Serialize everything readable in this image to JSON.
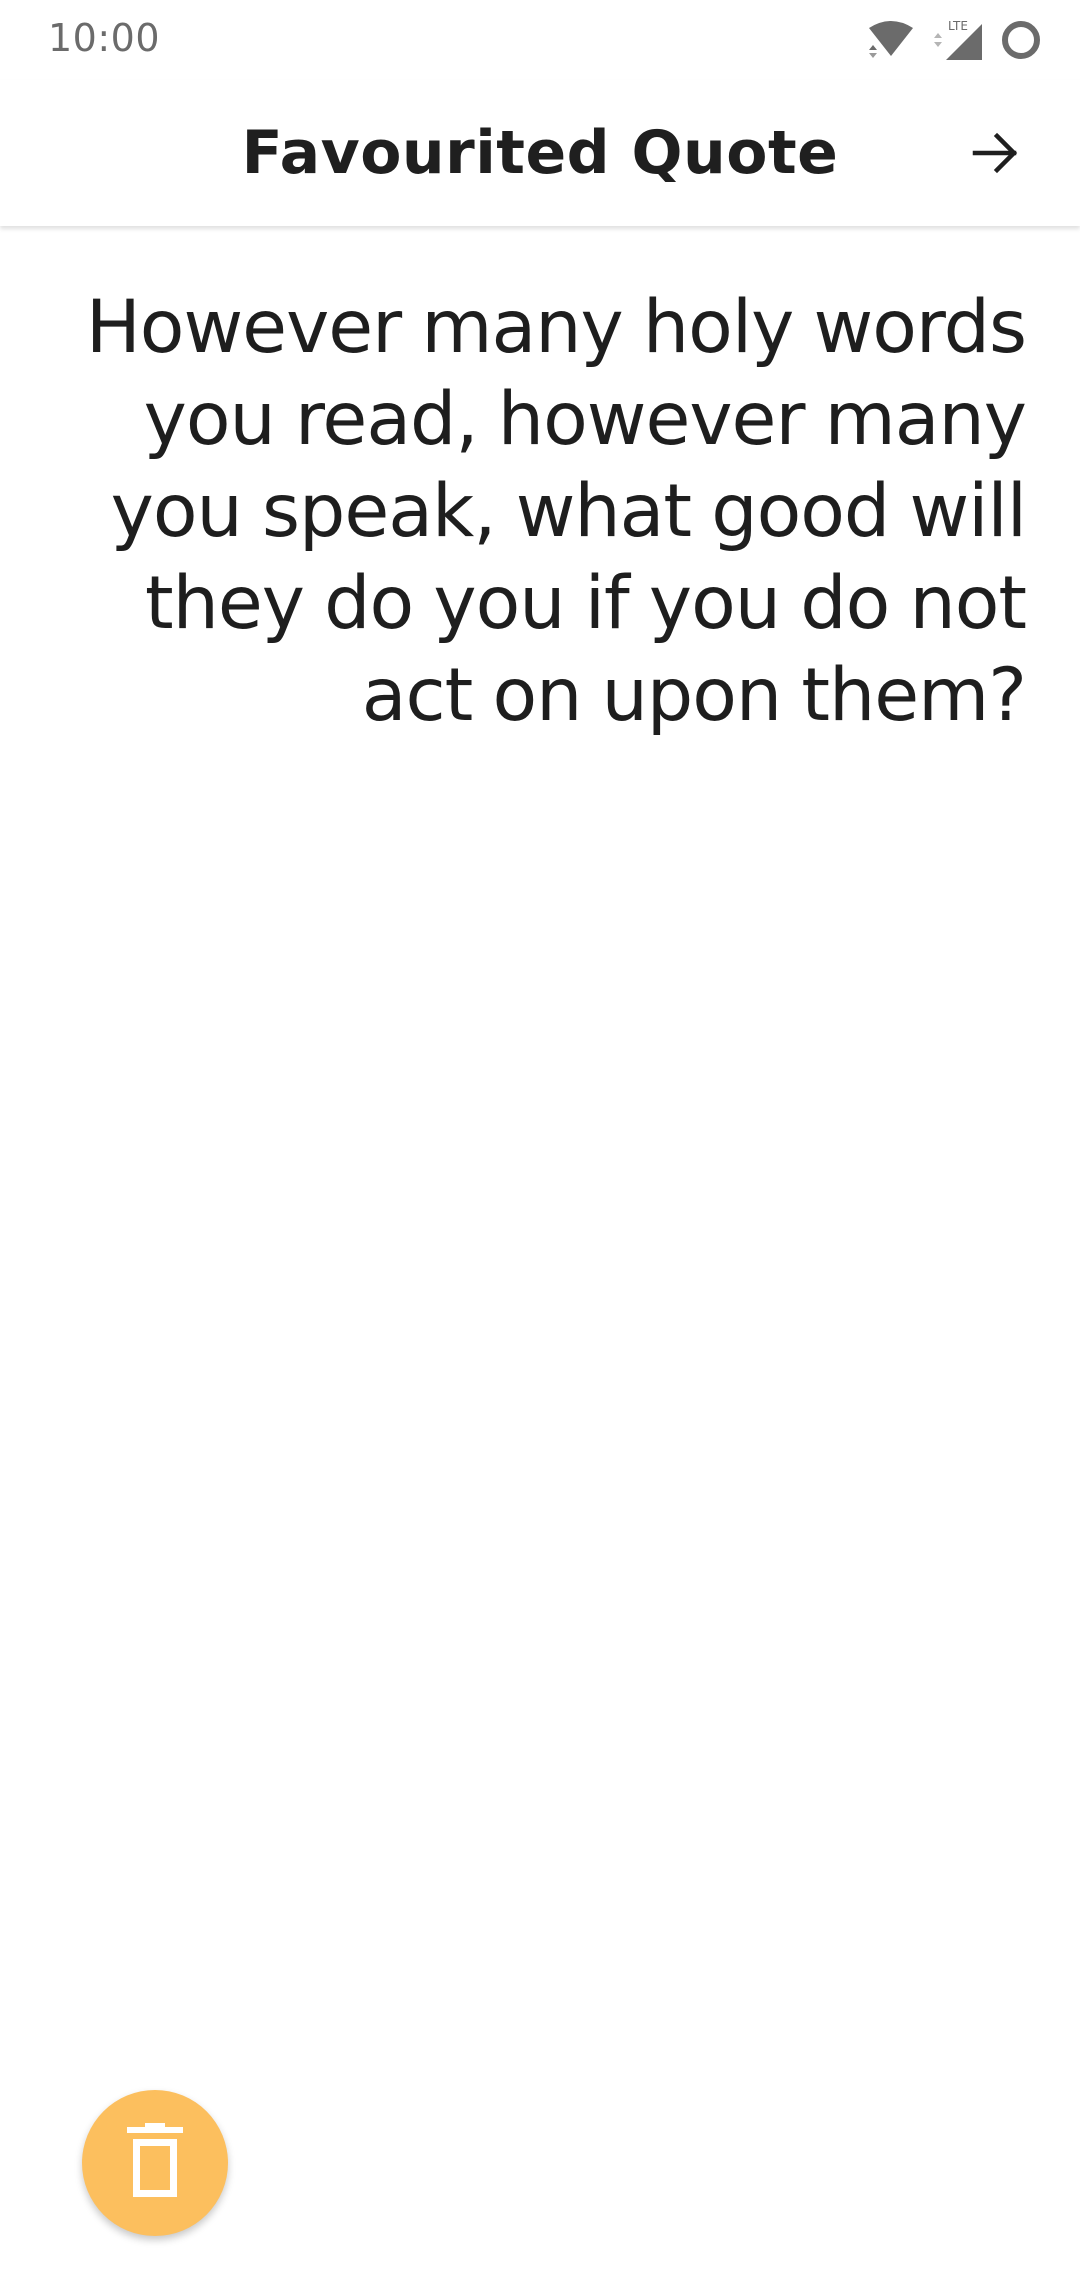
{
  "status_bar": {
    "time": "10:00",
    "network_label": "LTE",
    "icons": [
      "wifi-icon",
      "cell-signal-icon",
      "battery-icon"
    ]
  },
  "app_bar": {
    "title": "Favourited Quote",
    "next_icon": "arrow-right-icon"
  },
  "quote": {
    "text": "However many holy words you read, however many you speak, what good will they do you if you do not act on upon them?"
  },
  "fab": {
    "icon": "trash-icon",
    "color": "#fcbf5e"
  },
  "colors": {
    "accent": "#fcbf5e",
    "text": "#1e1e1e",
    "status_text": "#6b6b6b",
    "background": "#ffffff"
  }
}
